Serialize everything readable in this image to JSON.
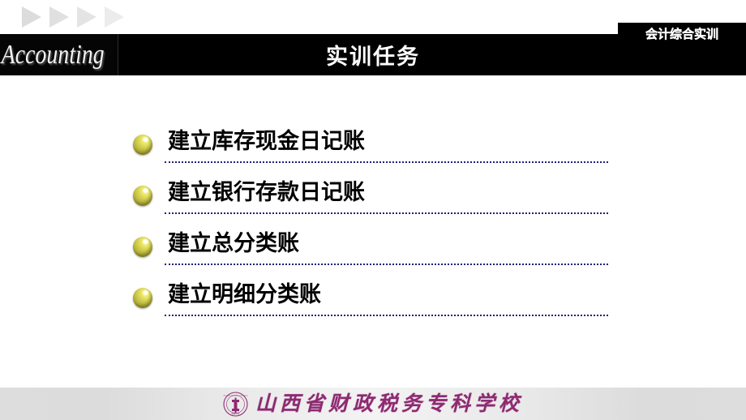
{
  "deco": {
    "arrows": [
      "arrow-1",
      "arrow-2",
      "arrow-3",
      "arrow-4"
    ]
  },
  "header": {
    "badge_label": "会计综合实训",
    "logo_text": "Accounting",
    "title": "实训任务",
    "bar_color": "#000000",
    "text_color": "#ffffff"
  },
  "main": {
    "tasks": [
      {
        "label": "建立库存现金日记账",
        "bullet": "gold-sphere-bullet"
      },
      {
        "label": "建立银行存款日记账",
        "bullet": "gold-sphere-bullet"
      },
      {
        "label": "建立总分类账",
        "bullet": "gold-sphere-bullet"
      },
      {
        "label": "建立明细分类账",
        "bullet": "gold-sphere-bullet"
      }
    ],
    "rule_color": "#1f1f7a",
    "text_color": "#000000"
  },
  "footer": {
    "school_name": "山西省财政税务专科学校",
    "seal_icon": "school-seal-icon",
    "accent_color": "#8e2a72",
    "band_color": "#e4e4e4"
  }
}
